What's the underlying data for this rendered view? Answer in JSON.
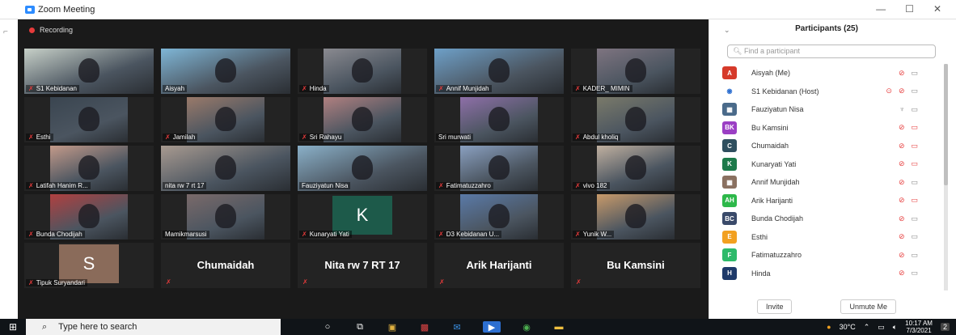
{
  "window": {
    "title": "Zoom Meeting",
    "minimize": "—",
    "maximize": "☐",
    "close": "✕"
  },
  "meeting": {
    "recording_label": "Recording",
    "tiles": [
      {
        "label": "S1 Kebidanan",
        "video": true,
        "wide": true,
        "active": false,
        "muted": true,
        "tint": "#c7d0c8"
      },
      {
        "label": "Aisyah",
        "video": true,
        "wide": true,
        "active": false,
        "muted": false,
        "tint": "#7fb6d6"
      },
      {
        "label": "Hinda",
        "video": true,
        "wide": false,
        "active": false,
        "muted": true,
        "tint": "#8a8a90"
      },
      {
        "label": "Annif Munjidah",
        "video": true,
        "wide": true,
        "active": false,
        "muted": true,
        "tint": "#6ea0c8"
      },
      {
        "label": "KADER_ MIMIN",
        "video": true,
        "wide": false,
        "active": false,
        "muted": true,
        "tint": "#7e7480"
      },
      {
        "label": "Esthi",
        "video": true,
        "wide": false,
        "active": false,
        "muted": true,
        "tint": "#3a4550"
      },
      {
        "label": "Jamilah",
        "video": true,
        "wide": false,
        "active": false,
        "muted": true,
        "tint": "#9a7a6a"
      },
      {
        "label": "Sri Rahayu",
        "video": true,
        "wide": false,
        "active": false,
        "muted": true,
        "tint": "#b08080"
      },
      {
        "label": "Sri murwati",
        "video": true,
        "wide": false,
        "active": false,
        "muted": false,
        "tint": "#8e6fa8"
      },
      {
        "label": "Abdul kholiq",
        "video": true,
        "wide": false,
        "active": false,
        "muted": true,
        "tint": "#7a7a6a"
      },
      {
        "label": "Latifah Hanim R...",
        "video": true,
        "wide": false,
        "active": false,
        "muted": true,
        "tint": "#c39a8a"
      },
      {
        "label": "nita rw 7 rt 17",
        "video": true,
        "wide": true,
        "active": false,
        "muted": false,
        "tint": "#a89a90"
      },
      {
        "label": "Fauziyatun Nisa",
        "video": true,
        "wide": true,
        "active": true,
        "muted": false,
        "tint": "#8ab0c8"
      },
      {
        "label": "Fatimatuzzahro",
        "video": true,
        "wide": false,
        "active": false,
        "muted": true,
        "tint": "#8aa0c0"
      },
      {
        "label": "vivo 182",
        "video": true,
        "wide": false,
        "active": false,
        "muted": true,
        "tint": "#c0b0a0"
      },
      {
        "label": "Bunda Chodijah",
        "video": true,
        "wide": false,
        "active": false,
        "muted": true,
        "tint": "#b04040"
      },
      {
        "label": "Mamikmarsusi",
        "video": true,
        "wide": false,
        "active": false,
        "muted": false,
        "tint": "#7a6a6a"
      },
      {
        "label": "Kunaryati Yati",
        "avatar": "K",
        "avatar_bg": "#1d5a4a",
        "muted": true
      },
      {
        "label": "D3 Kebidanan U...",
        "video": true,
        "wide": false,
        "active": false,
        "muted": true,
        "tint": "#5a7aa8"
      },
      {
        "label": "Yunik W...",
        "video": true,
        "wide": false,
        "active": false,
        "muted": true,
        "tint": "#c89a6a"
      },
      {
        "label": "Tipuk Suryandari",
        "avatar": "S",
        "avatar_bg": "#8a6b5a",
        "muted": true
      },
      {
        "big_name": "Chumaidah",
        "muted": true
      },
      {
        "big_name": "Nita rw 7 RT 17",
        "muted": true
      },
      {
        "big_name": "Arik Harijanti",
        "muted": true
      },
      {
        "big_name": "Bu Kamsini",
        "muted": true
      }
    ]
  },
  "participants": {
    "title": "Participants (25)",
    "search_placeholder": "Find a participant",
    "list": [
      {
        "initials": "A",
        "color": "#d63a2a",
        "name": "Aisyah (Me)",
        "mic": "mic-off",
        "cam": "cam"
      },
      {
        "initials": "◉",
        "color": "#ffffff",
        "name": "S1 Kebidanan (Host)",
        "mic": "mic-off",
        "cam": "cam"
      },
      {
        "initials": "▦",
        "color": "#4a6a8a",
        "name": "Fauziyatun Nisa",
        "mic": "mic-on",
        "cam": "cam"
      },
      {
        "initials": "BK",
        "color": "#9b3fc4",
        "name": "Bu Kamsini",
        "mic": "mic-off",
        "cam": "cam-off"
      },
      {
        "initials": "C",
        "color": "#2f4f5f",
        "name": "Chumaidah",
        "mic": "mic-off",
        "cam": "cam-off"
      },
      {
        "initials": "K",
        "color": "#1d7a4a",
        "name": "Kunaryati Yati",
        "mic": "mic-off",
        "cam": "cam-off"
      },
      {
        "initials": "▦",
        "color": "#8a7060",
        "name": "Annif Munjidah",
        "mic": "mic-off",
        "cam": "cam"
      },
      {
        "initials": "AH",
        "color": "#2db84a",
        "name": "Arik Harijanti",
        "mic": "mic-off",
        "cam": "cam-off"
      },
      {
        "initials": "BC",
        "color": "#3a4a6a",
        "name": "Bunda Chodijah",
        "mic": "mic-off",
        "cam": "cam"
      },
      {
        "initials": "E",
        "color": "#f2a020",
        "name": "Esthi",
        "mic": "mic-off",
        "cam": "cam"
      },
      {
        "initials": "F",
        "color": "#2dba6a",
        "name": "Fatimatuzzahro",
        "mic": "mic-off",
        "cam": "cam"
      },
      {
        "initials": "H",
        "color": "#1e3a6a",
        "name": "Hinda",
        "mic": "mic-off",
        "cam": "cam"
      }
    ],
    "invite_label": "Invite",
    "unmute_label": "Unmute Me"
  },
  "taskbar": {
    "search_placeholder": "Type here to search",
    "weather": "30°C",
    "time": "10:17 AM",
    "date": "7/3/2021",
    "notification_count": "2"
  }
}
